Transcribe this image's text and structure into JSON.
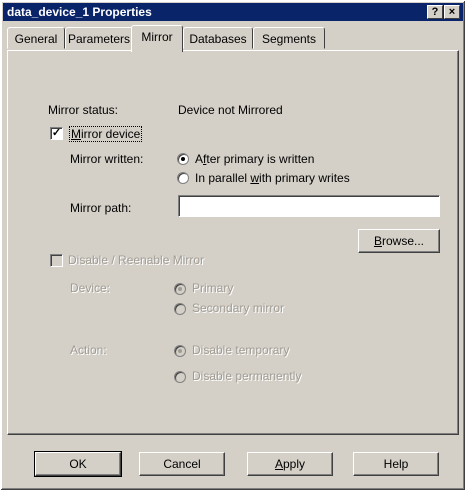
{
  "window": {
    "title": "data_device_1 Properties",
    "help_glyph": "?",
    "close_glyph": "×"
  },
  "tabs": [
    "General",
    "Parameters",
    "Mirror",
    "Databases",
    "Segments"
  ],
  "active_tab": "Mirror",
  "mirror": {
    "status_label": "Mirror status:",
    "status_value": "Device not Mirrored",
    "mirror_device_checkbox": {
      "label_u": "M",
      "label_rest": "irror device",
      "checked": true,
      "mark": "✓"
    },
    "mirror_written_label": "Mirror written:",
    "written_options": [
      {
        "u": "f",
        "pre": "A",
        "post": "ter primary is written",
        "selected": true
      },
      {
        "pre": "In parallel ",
        "u": "w",
        "post": "ith primary writes",
        "selected": false
      }
    ],
    "mirror_path_label": "Mirror path:",
    "mirror_path_value": "",
    "browse_button": {
      "u": "B",
      "rest": "rowse..."
    }
  },
  "disable_section": {
    "checkbox_label": "Disable / Reenable Mirror",
    "checked": false,
    "device_label": "Device:",
    "device_options": [
      {
        "label": "Primary",
        "selected": true
      },
      {
        "label": "Secondary mirror",
        "selected": false
      }
    ],
    "action_label": "Action:",
    "action_options": [
      {
        "label": "Disable temporary",
        "selected": true
      },
      {
        "label": "Disable permanently",
        "selected": false
      }
    ]
  },
  "footer_buttons": {
    "ok": "OK",
    "cancel": "Cancel",
    "apply_u": "A",
    "apply_rest": "pply",
    "help": "Help"
  }
}
